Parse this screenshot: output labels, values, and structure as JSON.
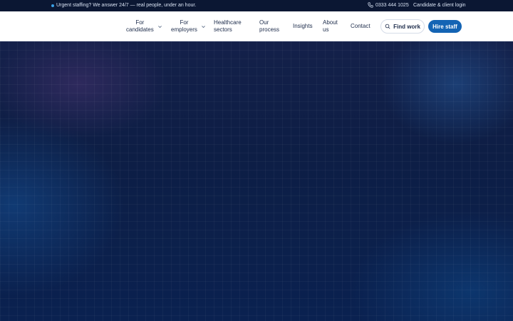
{
  "topbar": {
    "urgent_text": "Urgent staffing? We answer 24/7 — real people, under an hour.",
    "phone": "0333 444 1025",
    "login": "Candidate & client login"
  },
  "nav": {
    "items": [
      {
        "label": "For candidates",
        "line1": "For",
        "line2": "candidates",
        "dropdown": true
      },
      {
        "label": "For employers",
        "line1": "For",
        "line2": "employers",
        "dropdown": true
      },
      {
        "label": "Healthcare sectors",
        "line1": "Healthcare",
        "line2": "sectors",
        "dropdown": false
      },
      {
        "label": "Our process",
        "line1": "Our",
        "line2": "process",
        "dropdown": false
      },
      {
        "label": "Insights",
        "line1": "Insights",
        "line2": "",
        "dropdown": false
      },
      {
        "label": "About us",
        "line1": "About",
        "line2": "us",
        "dropdown": false
      },
      {
        "label": "Contact",
        "line1": "Contact",
        "line2": "",
        "dropdown": false
      }
    ],
    "find_work": "Find work",
    "hire_staff": "Hire staff"
  },
  "colors": {
    "topbar_bg": "#0b1733",
    "accent": "#1464b4",
    "nav_text": "#1c2b4a",
    "hero_bg": "#0d1e45"
  },
  "icons": {
    "status_dot": "status-dot-icon",
    "phone": "phone-icon",
    "search": "search-icon",
    "dropdown": "chevron-down-icon"
  }
}
